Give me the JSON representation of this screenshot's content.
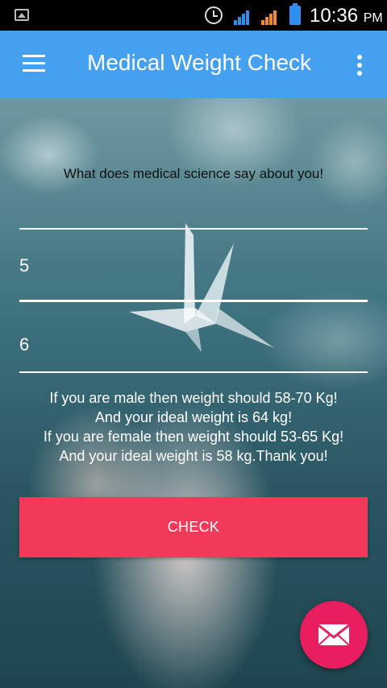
{
  "status_bar": {
    "time": "10:36",
    "ampm": "PM"
  },
  "app_bar": {
    "title": "Medical Weight Check"
  },
  "headline": "What does medical science say about you!",
  "inputs": {
    "feet": "5",
    "inches": "6"
  },
  "result": {
    "line1": "If you are male then weight should 58-70 Kg!",
    "line2": "And your ideal weight is 64 kg!",
    "line3": "If you are female then weight should 53-65 Kg!",
    "line4": "And your ideal weight is 58 kg.Thank you!"
  },
  "check_label": "CHECK",
  "colors": {
    "app_bar": "#46a0f0",
    "check_button": "#f3395a",
    "fab": "#e81e5f"
  },
  "icons": {
    "menu": "menu-icon",
    "more": "more-vert-icon",
    "fab": "mail-icon"
  }
}
